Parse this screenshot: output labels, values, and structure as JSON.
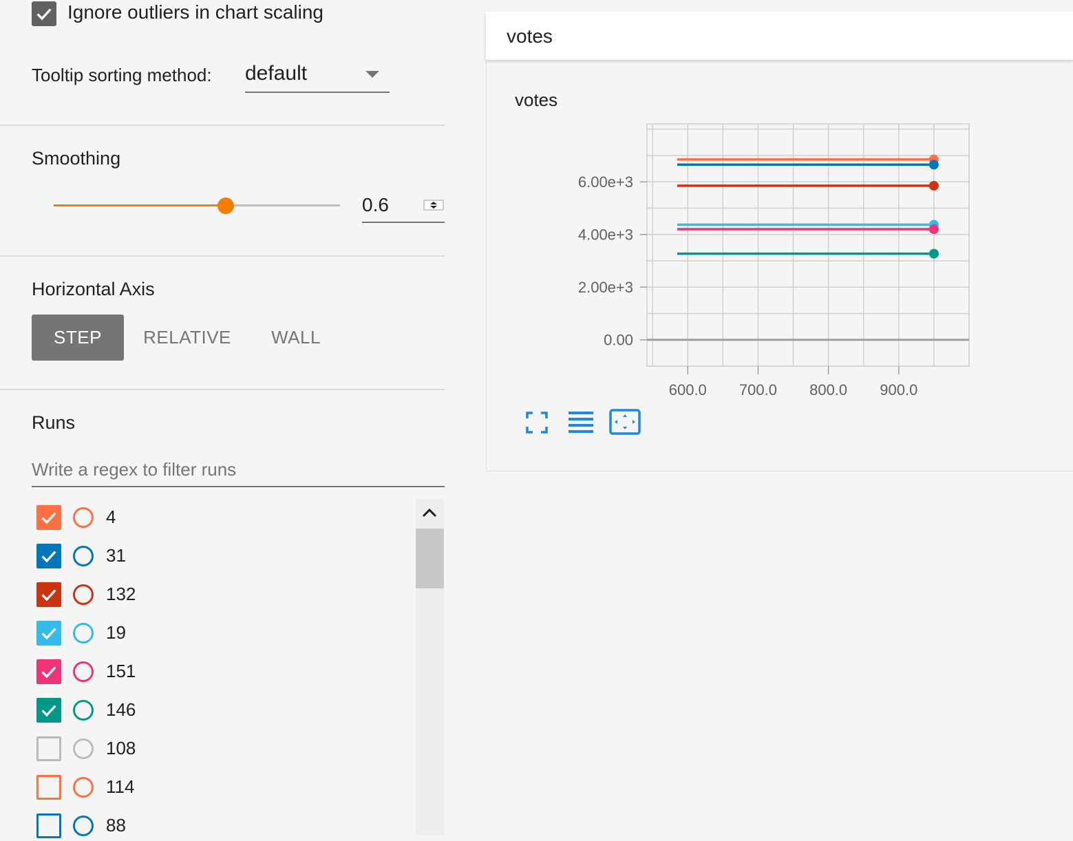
{
  "outliers": {
    "label": "Ignore outliers in chart scaling",
    "checked": true
  },
  "tooltip": {
    "label": "Tooltip sorting method:",
    "value": "default"
  },
  "smoothing": {
    "title": "Smoothing",
    "value": "0.6",
    "fraction": 0.6
  },
  "axis": {
    "title": "Horizontal Axis",
    "step": "STEP",
    "relative": "RELATIVE",
    "wall": "WALL",
    "selected": "STEP"
  },
  "runs": {
    "title": "Runs",
    "filter_placeholder": "Write a regex to filter runs",
    "items": [
      {
        "label": "4",
        "color": "#ff7043",
        "checked": true
      },
      {
        "label": "31",
        "color": "#0077bb",
        "checked": true
      },
      {
        "label": "132",
        "color": "#cc3311",
        "checked": true
      },
      {
        "label": "19",
        "color": "#33bbee",
        "checked": true
      },
      {
        "label": "151",
        "color": "#ee3377",
        "checked": true
      },
      {
        "label": "146",
        "color": "#009988",
        "checked": true
      },
      {
        "label": "108",
        "color": "#bbbbbb",
        "checked": false
      },
      {
        "label": "114",
        "color": "#ff7043",
        "checked": false
      },
      {
        "label": "88",
        "color": "#0077bb",
        "checked": false
      }
    ]
  },
  "card": {
    "header": "votes",
    "icons": [
      "fullscreen-icon",
      "legend-lines-icon",
      "fit-domain-icon"
    ]
  },
  "chart_data": {
    "type": "line",
    "title": "votes",
    "xlabel": "",
    "ylabel": "",
    "xlim": [
      542,
      1000
    ],
    "ylim": [
      -1000,
      8200
    ],
    "x_ticks": [
      "600.0",
      "700.0",
      "800.0",
      "900.0"
    ],
    "x_tick_values": [
      600,
      700,
      800,
      900
    ],
    "y_ticks": [
      "0.00",
      "2.00e+3",
      "4.00e+3",
      "6.00e+3"
    ],
    "y_tick_values": [
      0,
      2000,
      4000,
      6000
    ],
    "grid": true,
    "x": [
      585,
      950
    ],
    "series": [
      {
        "name": "4",
        "color": "#ff7043",
        "values": [
          6850,
          6850
        ]
      },
      {
        "name": "31",
        "color": "#0077bb",
        "values": [
          6650,
          6650
        ]
      },
      {
        "name": "132",
        "color": "#cc3311",
        "values": [
          5850,
          5850
        ]
      },
      {
        "name": "19",
        "color": "#33bbee",
        "values": [
          4370,
          4370
        ]
      },
      {
        "name": "151",
        "color": "#ee3377",
        "values": [
          4200,
          4200
        ]
      },
      {
        "name": "146",
        "color": "#009988",
        "values": [
          3270,
          3270
        ]
      }
    ]
  }
}
